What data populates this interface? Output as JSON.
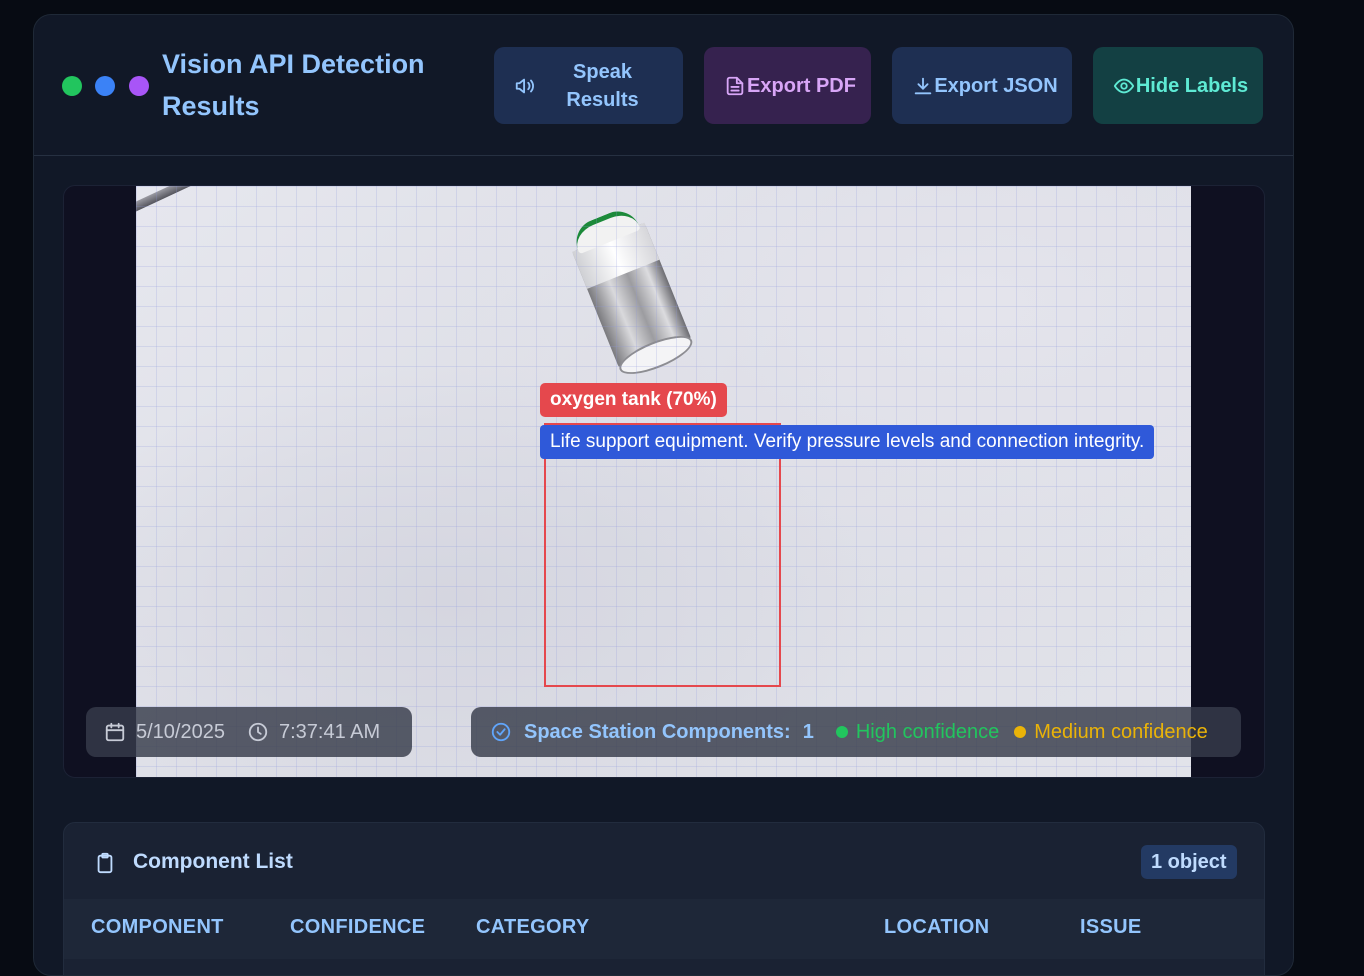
{
  "header": {
    "title": "Vision API Detection Results",
    "buttons": {
      "speak": "Speak Results",
      "export_pdf": "Export PDF",
      "export_json": "Export JSON",
      "hide_labels": "Hide Labels"
    }
  },
  "detection": {
    "label": "oxygen tank (70%)",
    "description": "Life support equipment. Verify pressure levels and connection integrity.",
    "box_color": "#e5484d"
  },
  "meta": {
    "date": "5/10/2025",
    "time": "7:37:41 AM"
  },
  "stats": {
    "label": "Space Station Components:",
    "count": "1",
    "legend": {
      "high": "High confidence",
      "medium": "Medium confidence"
    },
    "colors": {
      "high": "#22c55e",
      "medium": "#eab308"
    }
  },
  "component_list": {
    "title": "Component List",
    "badge": "1 object",
    "columns": [
      "COMPONENT",
      "CONFIDENCE",
      "CATEGORY",
      "LOCATION",
      "ISSUE"
    ]
  },
  "icons": {
    "window_dots": [
      "green",
      "blue",
      "purple"
    ],
    "speak": "speaker-icon",
    "pdf": "file-icon",
    "json": "download-icon",
    "hide": "eye-icon",
    "date": "calendar-icon",
    "time": "clock-icon",
    "stats": "check-circle-icon",
    "list": "clipboard-icon"
  }
}
